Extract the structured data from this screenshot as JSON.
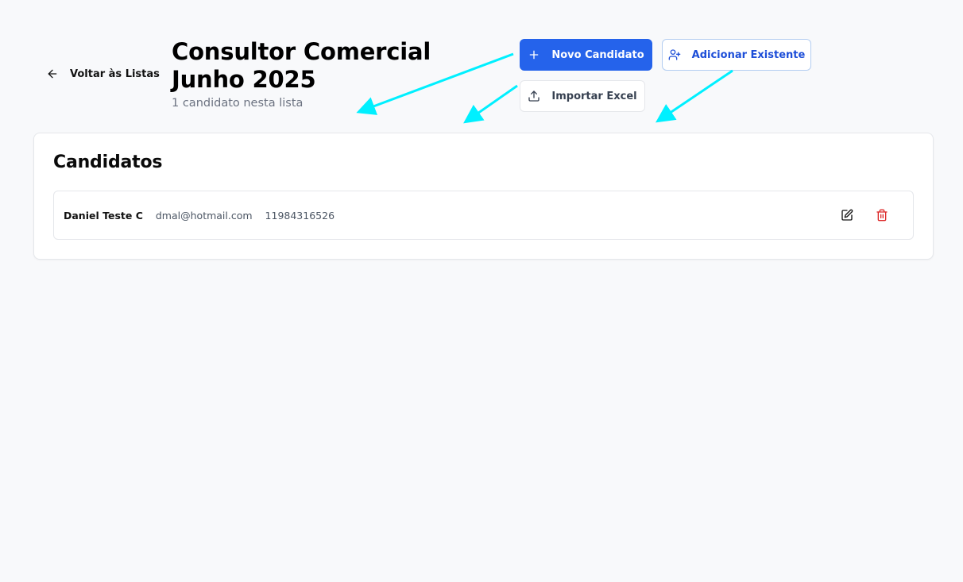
{
  "nav": {
    "back_label": "Voltar às Listas"
  },
  "header": {
    "title": "Consultor Comercial Junho 2025",
    "subtitle": "1 candidato nesta lista"
  },
  "actions": {
    "new_candidate_label": "Novo Candidato",
    "add_existing_label": "Adicionar Existente",
    "import_excel_label": "Importar Excel"
  },
  "candidates_section": {
    "title": "Candidatos",
    "items": [
      {
        "name": "Daniel Teste C",
        "email": "dmal@hotmail.com",
        "phone": "11984316526"
      }
    ]
  },
  "colors": {
    "primary": "#2563eb",
    "delete": "#dc2626",
    "annotation_arrow": "#00f0ff",
    "background": "#f8f9fb"
  },
  "icons": {
    "back": "arrow-left-icon",
    "new": "plus-icon",
    "add_existing": "user-plus-icon",
    "import": "upload-icon",
    "edit": "edit-icon",
    "delete": "trash-icon"
  }
}
